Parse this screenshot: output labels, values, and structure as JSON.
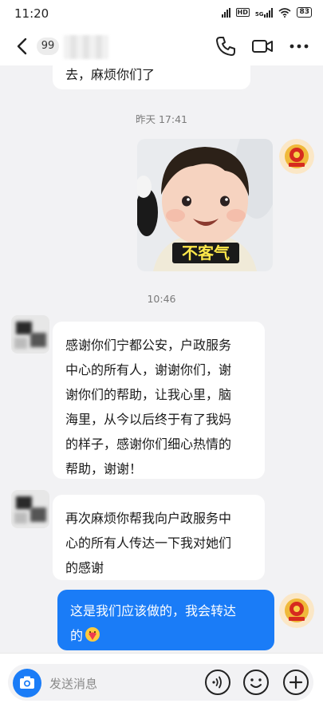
{
  "status_bar": {
    "time": "11:20",
    "network": "5G",
    "hd": "HD",
    "battery": "83"
  },
  "header": {
    "unread_count": "99"
  },
  "messages": {
    "partial_incoming": "去，麻烦你们了",
    "time_yesterday": "昨天 17:41",
    "sticker_caption": "不客气",
    "time_today": "10:46",
    "incoming_1": [
      "感谢你们宁都公安，户政服务",
      "中心的所有人，谢谢你们，谢",
      "谢你们的帮助，让我心里，脑",
      "海里，从今以后终于有了我妈",
      "的样子，感谢你们细心热情的",
      "帮助，谢谢！"
    ],
    "incoming_2": [
      "再次麻烦你帮我向户政服务中",
      "心的所有人传达一下我对她们",
      "的感谢"
    ],
    "outgoing_1": [
      "这是我们应该做的，我会转达",
      "的"
    ]
  },
  "input": {
    "placeholder": "发送消息"
  },
  "colors": {
    "accent": "#1a7cf7",
    "background": "#f2f2f4"
  }
}
